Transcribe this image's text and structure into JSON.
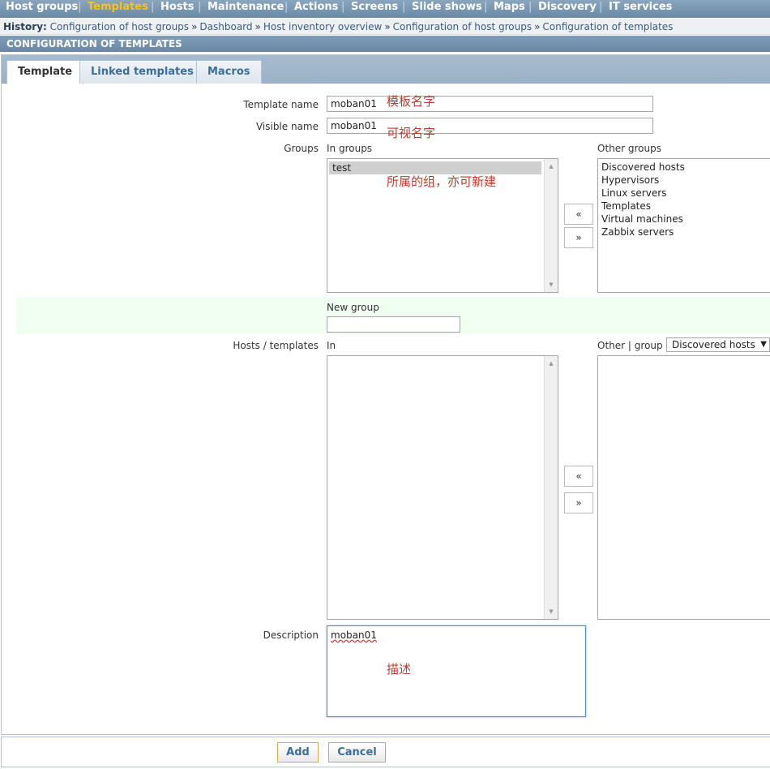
{
  "menu": {
    "items": [
      "Host groups",
      "Templates",
      "Hosts",
      "Maintenance",
      "Actions",
      "Screens",
      "Slide shows",
      "Maps",
      "Discovery",
      "IT services"
    ],
    "active_index": 1,
    "separator": "|"
  },
  "history": {
    "label": "History:",
    "arrow": "»",
    "items": [
      "Configuration of host groups",
      "Dashboard",
      "Host inventory overview",
      "Configuration of host groups",
      "Configuration of templates"
    ]
  },
  "page_title": "CONFIGURATION OF TEMPLATES",
  "tabs": [
    "Template",
    "Linked templates",
    "Macros"
  ],
  "form": {
    "template_name_label": "Template name",
    "template_name_value": "moban01",
    "template_name_note": "模板名字",
    "visible_name_label": "Visible name",
    "visible_name_value": "moban01",
    "visible_name_note": "可视名字",
    "groups_label": "Groups",
    "in_groups_label": "In groups",
    "in_groups": [
      "test"
    ],
    "groups_note": "所属的组，亦可新建",
    "other_groups_label": "Other groups",
    "other_groups": [
      "Discovered hosts",
      "Hypervisors",
      "Linux servers",
      "Templates",
      "Virtual machines",
      "Zabbix servers"
    ],
    "move_left": "«",
    "move_right": "»",
    "new_group_label": "New group",
    "new_group_value": "",
    "hosts_label": "Hosts / templates",
    "hosts_in_label": "In",
    "hosts_other_label": "Other",
    "hosts_group_label": "group",
    "hosts_group_select": "Discovered hosts",
    "description_label": "Description",
    "description_value": "moban01",
    "description_note": "描述"
  },
  "buttons": {
    "add": "Add",
    "cancel": "Cancel"
  }
}
